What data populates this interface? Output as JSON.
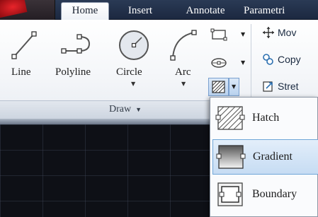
{
  "tabs": [
    {
      "label": "Home",
      "active": true
    },
    {
      "label": "Insert",
      "active": false
    },
    {
      "label": "Annotate",
      "active": false
    },
    {
      "label": "Parametri",
      "active": false
    }
  ],
  "draw_panel": {
    "title": "Draw",
    "tools": [
      {
        "label": "Line",
        "icon": "line-icon"
      },
      {
        "label": "Polyline",
        "icon": "polyline-icon"
      },
      {
        "label": "Circle",
        "icon": "circle-icon"
      },
      {
        "label": "Arc",
        "icon": "arc-icon"
      }
    ],
    "small_tools": [
      {
        "icon": "rectangle-icon"
      },
      {
        "icon": "ellipse-icon"
      },
      {
        "icon": "hatch-icon"
      }
    ]
  },
  "modify_panel": {
    "items": [
      {
        "label": "Mov",
        "icon": "move-icon"
      },
      {
        "label": "Copy",
        "icon": "copy-icon"
      },
      {
        "label": "Stret",
        "icon": "stretch-icon"
      }
    ]
  },
  "hatch_dropdown": {
    "items": [
      {
        "label": "Hatch",
        "icon": "hatch-icon",
        "selected": false
      },
      {
        "label": "Gradient",
        "icon": "gradient-icon",
        "selected": true
      },
      {
        "label": "Boundary",
        "icon": "boundary-icon",
        "selected": false
      }
    ]
  },
  "colors": {
    "tab_bar": "#1c2840",
    "ribbon": "#f4f6f9",
    "selection": "#c6dcf3",
    "canvas": "#0e1016",
    "app_logo": "#d6181e"
  }
}
